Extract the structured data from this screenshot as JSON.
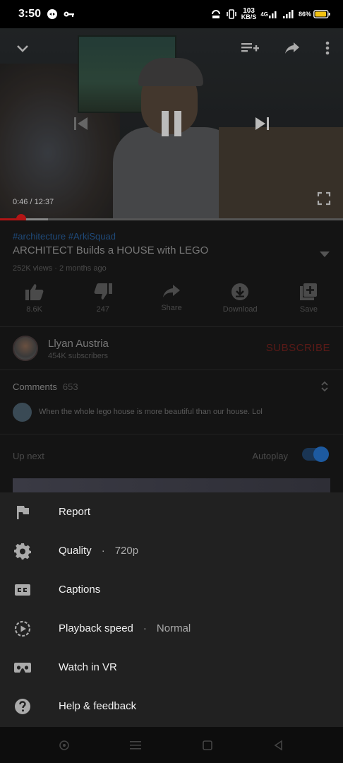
{
  "status_bar": {
    "time": "3:50",
    "net_speed_value": "103",
    "net_speed_unit": "KB/S",
    "network_type": "4G",
    "battery": "86%"
  },
  "player": {
    "time_current": "0:46",
    "time_total": "12:37",
    "time_separator": " / ",
    "progress_fraction": 0.061,
    "buffer_fraction": 0.14,
    "accent_color": "#b31515"
  },
  "video": {
    "hashtags": "#architecture #ArkiSquad",
    "title": "ARCHITECT Builds a HOUSE with LEGO",
    "meta": "252K views · 2 months ago"
  },
  "actions": [
    {
      "icon": "thumb-up-icon",
      "label": "8.6K"
    },
    {
      "icon": "thumb-down-icon",
      "label": "247"
    },
    {
      "icon": "share-icon",
      "label": "Share"
    },
    {
      "icon": "download-icon",
      "label": "Download"
    },
    {
      "icon": "save-icon",
      "label": "Save"
    }
  ],
  "channel": {
    "name": "Llyan Austria",
    "subscribers": "454K subscribers",
    "subscribe_label": "SUBSCRIBE"
  },
  "comments": {
    "label": "Comments",
    "count": "653",
    "top_comment": "When the whole lego house is more beautiful than our house. Lol"
  },
  "up_next": {
    "label": "Up next",
    "autoplay_label": "Autoplay",
    "autoplay_on": true
  },
  "menu": {
    "items": [
      {
        "icon": "flag-icon",
        "label": "Report",
        "value": ""
      },
      {
        "icon": "gear-icon",
        "label": "Quality",
        "value": "720p"
      },
      {
        "icon": "captions-icon",
        "label": "Captions",
        "value": ""
      },
      {
        "icon": "playback-speed-icon",
        "label": "Playback speed",
        "value": "Normal"
      },
      {
        "icon": "vr-icon",
        "label": "Watch in VR",
        "value": ""
      },
      {
        "icon": "help-icon",
        "label": "Help & feedback",
        "value": ""
      }
    ],
    "value_separator": "·"
  }
}
